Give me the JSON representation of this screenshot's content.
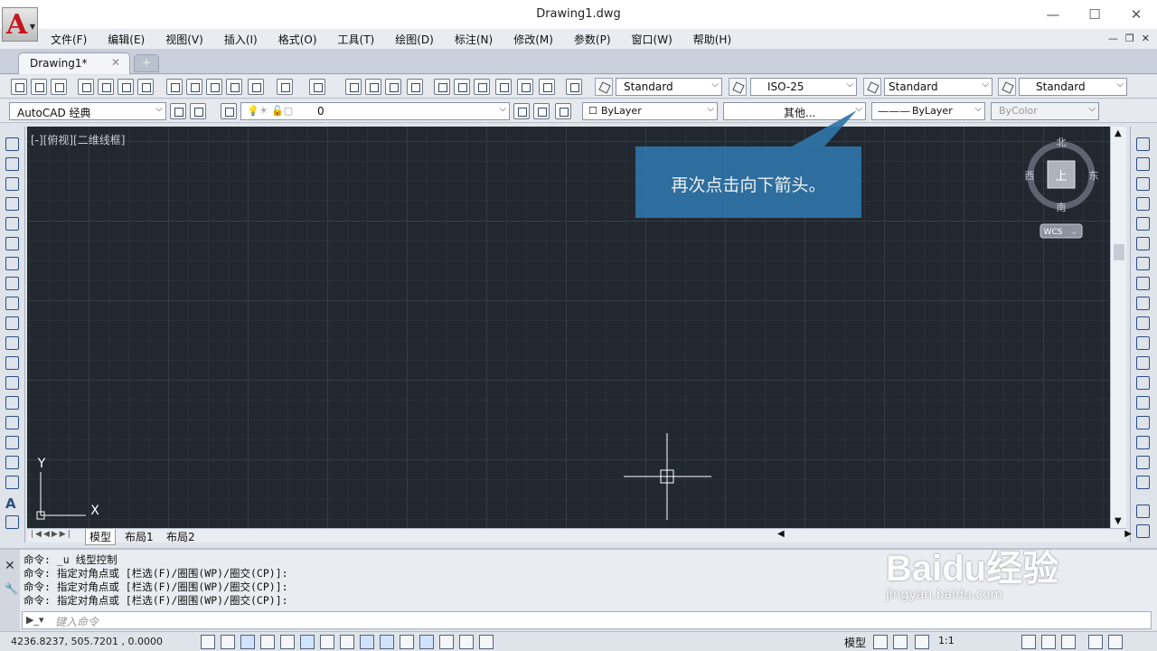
{
  "title": {
    "filename": "Drawing1.dwg"
  },
  "menu": [
    "文件(F)",
    "编辑(E)",
    "视图(V)",
    "插入(I)",
    "格式(O)",
    "工具(T)",
    "绘图(D)",
    "标注(N)",
    "修改(M)",
    "参数(P)",
    "窗口(W)",
    "帮助(H)"
  ],
  "tabs": {
    "active": "Drawing1*"
  },
  "styles": {
    "text_style": "Standard",
    "dim_style": "ISO-25",
    "table_style": "Standard",
    "mleader_style": "Standard"
  },
  "workspace": "AutoCAD 经典",
  "layer": "0",
  "properties": {
    "color": "ByLayer",
    "linetype": "其他...",
    "lineweight": "ByLayer",
    "plotstyle": "ByColor"
  },
  "viewport": {
    "label": "[-][俯视][二维线框]"
  },
  "viewcube": {
    "north": "北",
    "south": "南",
    "east": "东",
    "west": "西",
    "face": "上",
    "wcs": "WCS"
  },
  "ucs": {
    "x": "X",
    "y": "Y"
  },
  "layout_tabs": [
    "模型",
    "布局1",
    "布局2"
  ],
  "command": {
    "history": [
      "命令: _u 线型控制",
      "命令: 指定对角点或 [栏选(F)/圈围(WP)/圈交(CP)]:",
      "命令: 指定对角点或 [栏选(F)/圈围(WP)/圈交(CP)]:",
      "命令: 指定对角点或 [栏选(F)/圈围(WP)/圈交(CP)]:"
    ],
    "placeholder": "键入命令"
  },
  "status": {
    "coords": "4236.8237, 505.7201 , 0.0000",
    "model": "模型",
    "scale": "1:1"
  },
  "callout": "再次点击向下箭头。",
  "watermark": {
    "brand": "Baidu经验",
    "url": "jingyan.baidu.com"
  },
  "colors": {
    "canvas": "#212830",
    "callout": "#2f75a8",
    "logo": "#c4161c"
  }
}
